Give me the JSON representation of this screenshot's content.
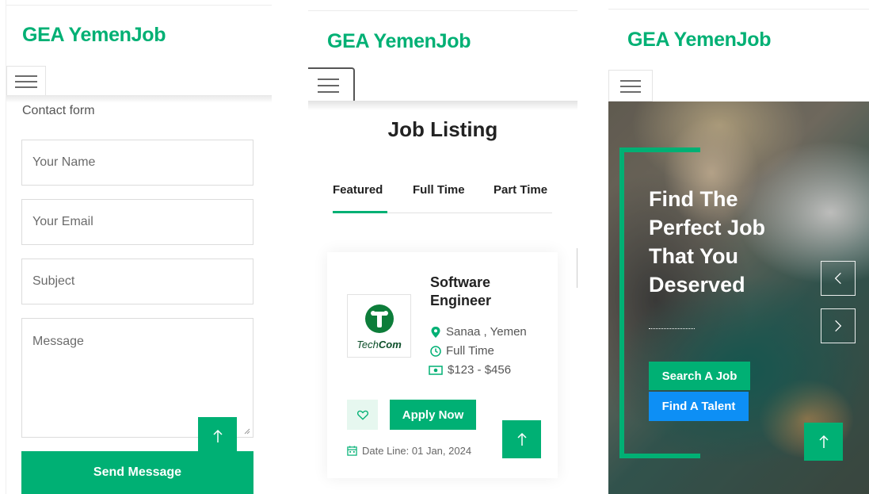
{
  "colors": {
    "brand": "#00b074",
    "blue": "#0d8ff5"
  },
  "panel1": {
    "brand": "GEA YemenJob",
    "menu_icon": "hamburger-icon",
    "form_title": "Contact form",
    "fields": {
      "name_placeholder": "Your Name",
      "email_placeholder": "Your Email",
      "subject_placeholder": "Subject",
      "message_placeholder": "Message"
    },
    "send_label": "Send Message",
    "totop_icon": "arrow-up-icon"
  },
  "panel2": {
    "brand": "GEA YemenJob",
    "menu_icon": "hamburger-icon",
    "title": "Job Listing",
    "tabs": [
      {
        "label": "Featured",
        "active": true
      },
      {
        "label": "Full Time",
        "active": false
      },
      {
        "label": "Part Time",
        "active": false
      }
    ],
    "job": {
      "title_line1": "Software",
      "title_line2": "Engineer",
      "company_logo_text": "TechCom",
      "location": "Sanaa , Yemen",
      "type": "Full Time",
      "salary": "$123 - $456",
      "apply_label": "Apply Now",
      "date_line": "Date Line: 01 Jan, 2024"
    },
    "totop_icon": "arrow-up-icon"
  },
  "panel3": {
    "brand": "GEA YemenJob",
    "menu_icon": "hamburger-icon",
    "hero_title_lines": [
      "Find The",
      "Perfect Job",
      "That You",
      "Deserved"
    ],
    "search_label": "Search A Job",
    "talent_label": "Find A Talent",
    "prev_icon": "chevron-left-icon",
    "next_icon": "chevron-right-icon",
    "totop_icon": "arrow-up-icon"
  }
}
